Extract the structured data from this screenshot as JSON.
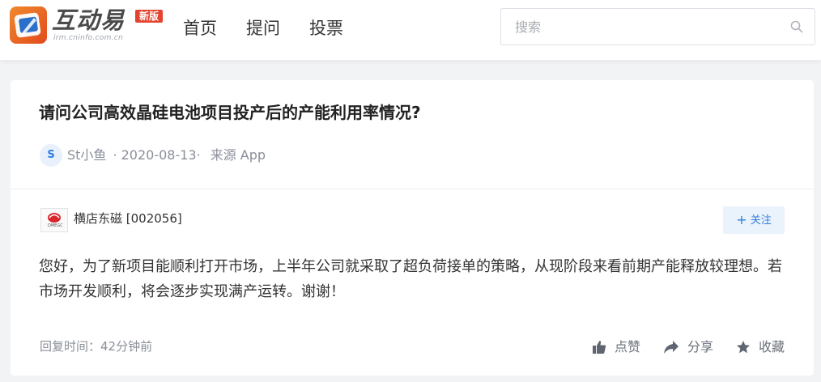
{
  "header": {
    "logo": {
      "name": "互动易",
      "domain": "irm.cninfo.com.cn",
      "badge": "新版"
    },
    "nav": [
      {
        "label": "首页"
      },
      {
        "label": "提问"
      },
      {
        "label": "投票"
      }
    ],
    "search": {
      "placeholder": "搜索",
      "value": ""
    }
  },
  "question": {
    "title": "请问公司高效晶硅电池项目投产后的产能利用率情况?",
    "asker_avatar_letter": "S",
    "asker_name": "St小鱼",
    "date": "· 2020-08-13·",
    "source": "来源 App"
  },
  "answer": {
    "company_name": "横店东磁 [002056]",
    "company_logo_text": "DMEGC",
    "follow_label": "关注",
    "text": "您好，为了新项目能顺利打开市场，上半年公司就采取了超负荷接单的策略，从现阶段来看前期产能释放较理想。若市场开发顺利，将会逐步实现满产运转。谢谢！",
    "reply_time": "回复时间：42分钟前",
    "actions": {
      "like": "点赞",
      "share": "分享",
      "collect": "收藏"
    }
  },
  "colors": {
    "accent": "#2f7de1",
    "logo_orange": "#e24a1c",
    "badge_red": "#e2442f",
    "page_bg": "#f2f3f5"
  },
  "icons": [
    "logo-mark-icon",
    "search-icon",
    "dmegc-logo-icon",
    "thumbs-up-icon",
    "share-arrow-icon",
    "star-icon"
  ]
}
